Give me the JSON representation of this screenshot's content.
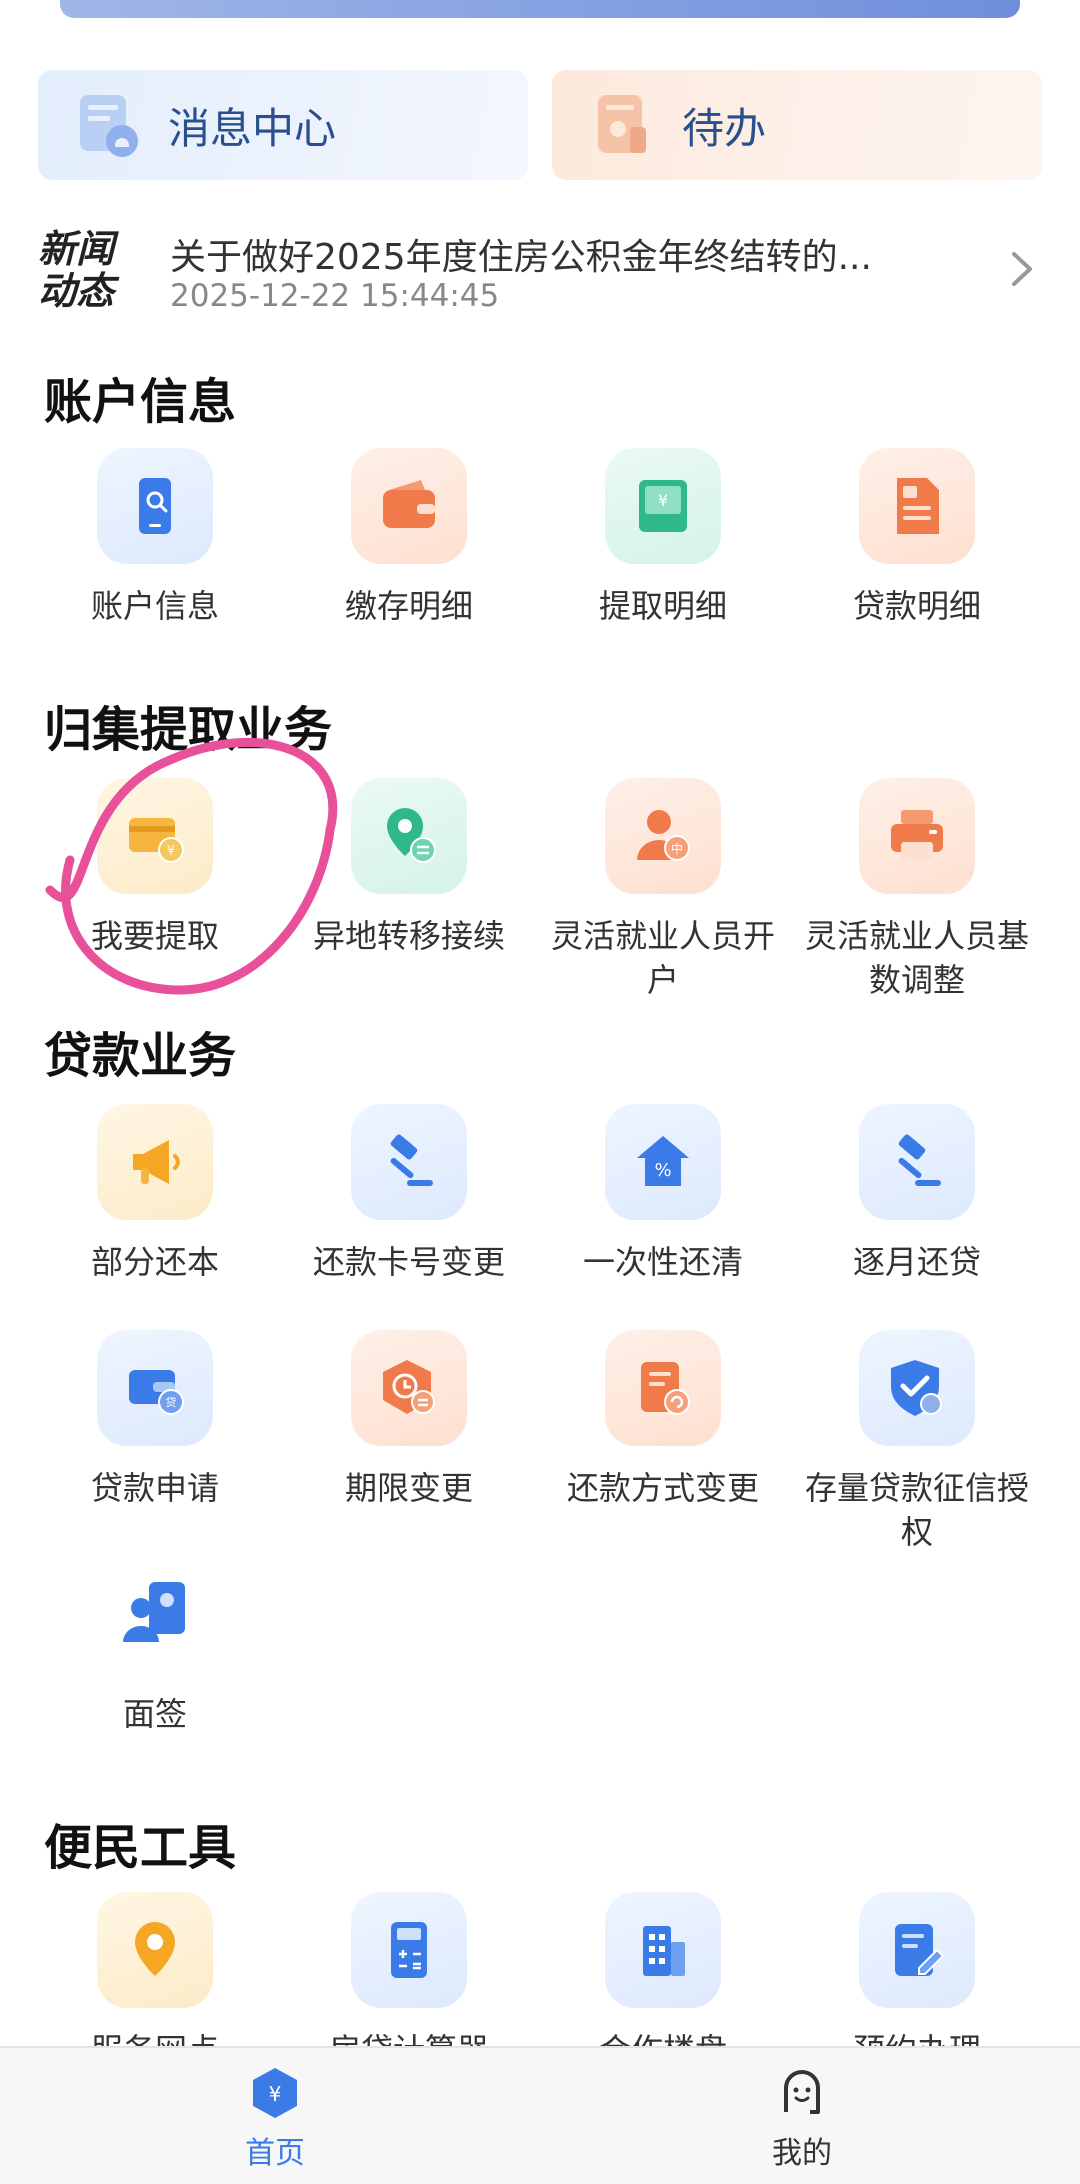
{
  "cards": [
    {
      "label": "消息中心"
    },
    {
      "label": "待办"
    }
  ],
  "news": {
    "logo_line1": "新闻",
    "logo_line2": "动态",
    "title": "关于做好2025年度住房公积金年终结转的...",
    "time": "2025-12-22 15:44:45"
  },
  "sections": {
    "account": {
      "title": "账户信息",
      "items": [
        "账户信息",
        "缴存明细",
        "提取明细",
        "贷款明细"
      ]
    },
    "collect": {
      "title": "归集提取业务",
      "items": [
        "我要提取",
        "异地转移接续",
        "灵活就业人员开户",
        "灵活就业人员基数调整"
      ]
    },
    "loan": {
      "title": "贷款业务",
      "items": [
        "部分还本",
        "还款卡号变更",
        "一次性还清",
        "逐月还贷",
        "贷款申请",
        "期限变更",
        "还款方式变更",
        "存量贷款征信授权",
        "面签"
      ]
    },
    "tools": {
      "title": "便民工具",
      "items": [
        "服务网点",
        "房贷计算器",
        "合作楼盘",
        "预约办理"
      ]
    }
  },
  "tabbar": {
    "home": "首页",
    "mine": "我的"
  },
  "colors": {
    "accent": "#3a7be8",
    "orange": "#f07a4a",
    "green": "#2fb98a",
    "annotation": "#e8509a"
  }
}
